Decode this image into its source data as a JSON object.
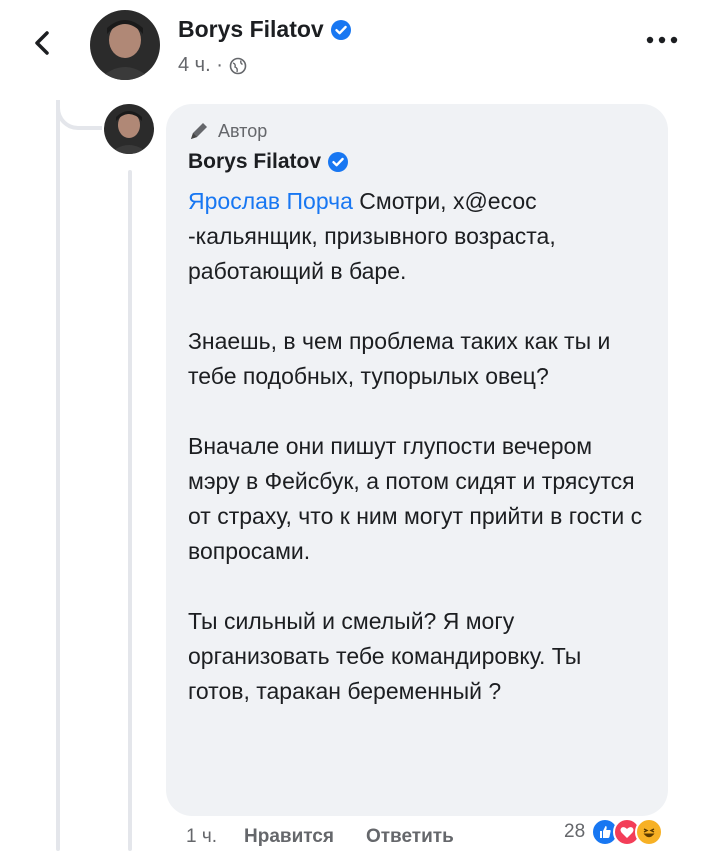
{
  "header": {
    "name": "Borys Filatov",
    "time": "4 ч. ·"
  },
  "comment": {
    "author_badge": "Автор",
    "name": "Borys Filatov",
    "mention": "Ярослав Порча",
    "paragraphs": [
      " Смотри, х@есос -кальянщик, призывного возраста, работающий в баре.",
      "Знаешь, в чем проблема таких как ты и тебе подобных, тупорылых овец?",
      "Вначале они пишут глупости вечером мэру в Фейсбук, а потом сидят и трясутся от страху, что к ним могут прийти в гости с вопросами.",
      "Ты сильный и смелый? Я могу организовать тебе командировку. Ты готов, таракан беременный ?"
    ]
  },
  "actions": {
    "time": "1 ч.",
    "like": "Нравится",
    "reply": "Ответить",
    "reaction_count": "28"
  },
  "colors": {
    "accent": "#1877f2",
    "bubble": "#f0f2f5",
    "muted": "#65676b"
  }
}
